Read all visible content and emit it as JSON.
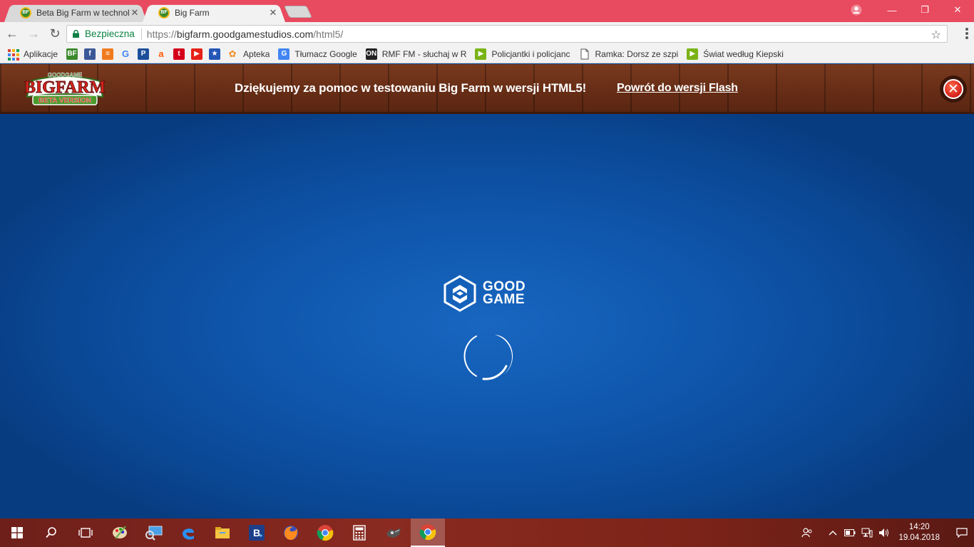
{
  "browser": {
    "tabs": [
      {
        "title": "Beta Big Farm w technolo",
        "favicon": "BF"
      },
      {
        "title": "Big Farm",
        "favicon": "BF"
      }
    ],
    "secure_label": "Bezpieczna",
    "url_proto": "https://",
    "url_host": "bigfarm.goodgamestudios.com",
    "url_path": "/html5/",
    "bookmarks": [
      {
        "label": "Aplikacje",
        "icon": "apps-icon"
      },
      {
        "label": "",
        "icon": "bigfarm-icon",
        "glyph": "BF",
        "color": "#3b8a2b"
      },
      {
        "label": "",
        "icon": "facebook-icon",
        "glyph": "f",
        "color": "#3b5998"
      },
      {
        "label": "",
        "icon": "layers-icon",
        "glyph": "≡",
        "color": "#f07b1f"
      },
      {
        "label": "",
        "icon": "google-icon",
        "glyph": "G",
        "color": "#4285f4"
      },
      {
        "label": "",
        "icon": "pko-icon",
        "glyph": "P",
        "color": "#1b4f9b"
      },
      {
        "label": "",
        "icon": "allegro-icon",
        "glyph": "a",
        "color": "#ff5a00"
      },
      {
        "label": "",
        "icon": "tui-icon",
        "glyph": "t",
        "color": "#d4001a"
      },
      {
        "label": "",
        "icon": "youtube-icon",
        "glyph": "▶",
        "color": "#e62117"
      },
      {
        "label": "",
        "icon": "star-bookmark-icon",
        "glyph": "★",
        "color": "#2456b8"
      },
      {
        "label": "Apteka",
        "icon": "apteka-icon",
        "glyph": "✿",
        "color": "#f08a24"
      },
      {
        "label": "Tłumacz Google",
        "icon": "translate-icon",
        "glyph": "G",
        "color": "#4285f4"
      },
      {
        "label": "RMF FM - słuchaj w R",
        "icon": "rmf-icon",
        "glyph": "ON",
        "color": "#222222"
      },
      {
        "label": "Policjantki i policjanc",
        "icon": "player-icon",
        "glyph": "▶",
        "color": "#7ab317"
      },
      {
        "label": "Ramka: Dorsz ze szpi",
        "icon": "page-icon",
        "glyph": "",
        "color": "#ffffff"
      },
      {
        "label": "Świat według Kiepski",
        "icon": "player-icon",
        "glyph": "▶",
        "color": "#7ab317"
      }
    ]
  },
  "game": {
    "logo_top": "GOODGAME",
    "logo_main": "BIGFARM",
    "logo_sub": "BETA VERSION",
    "header_message": "Dziękujemy za pomoc w testowaniu Big Farm w wersji HTML5!",
    "flash_link": "Powrót do wersji Flash",
    "loader_brand_line1": "GOOD",
    "loader_brand_line2": "GAME"
  },
  "taskbar": {
    "time": "14:20",
    "date": "19.04.2018"
  },
  "colors": {
    "chrome_frame": "#e84a5f",
    "secure_green": "#0b8043",
    "wood": "#6a2f17",
    "game_blue": "#0f56ac",
    "taskbar": "#7d2419"
  }
}
